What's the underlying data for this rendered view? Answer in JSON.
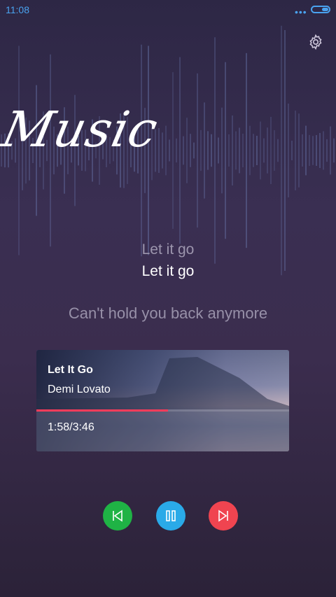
{
  "status_bar": {
    "time": "11:08",
    "indicator": "•••"
  },
  "header": {
    "title": "Music",
    "settings_icon": "gear-icon"
  },
  "lyrics": {
    "previous": "Let it go",
    "current": "Let it go",
    "next": "Can't hold you back anymore"
  },
  "now_playing": {
    "title": "Let It Go",
    "artist": "Demi Lovato",
    "time": "1:58/3:46",
    "progress": 0.52
  },
  "controls": {
    "previous_icon": "skip-previous-icon",
    "pause_icon": "pause-icon",
    "next_icon": "skip-next-icon"
  },
  "colors": {
    "accent": "#4aa3f0",
    "progress": "#ff3c5a",
    "previous_button": "#1fb345",
    "pause_button": "#2aaae8",
    "next_button": "#f04450"
  }
}
